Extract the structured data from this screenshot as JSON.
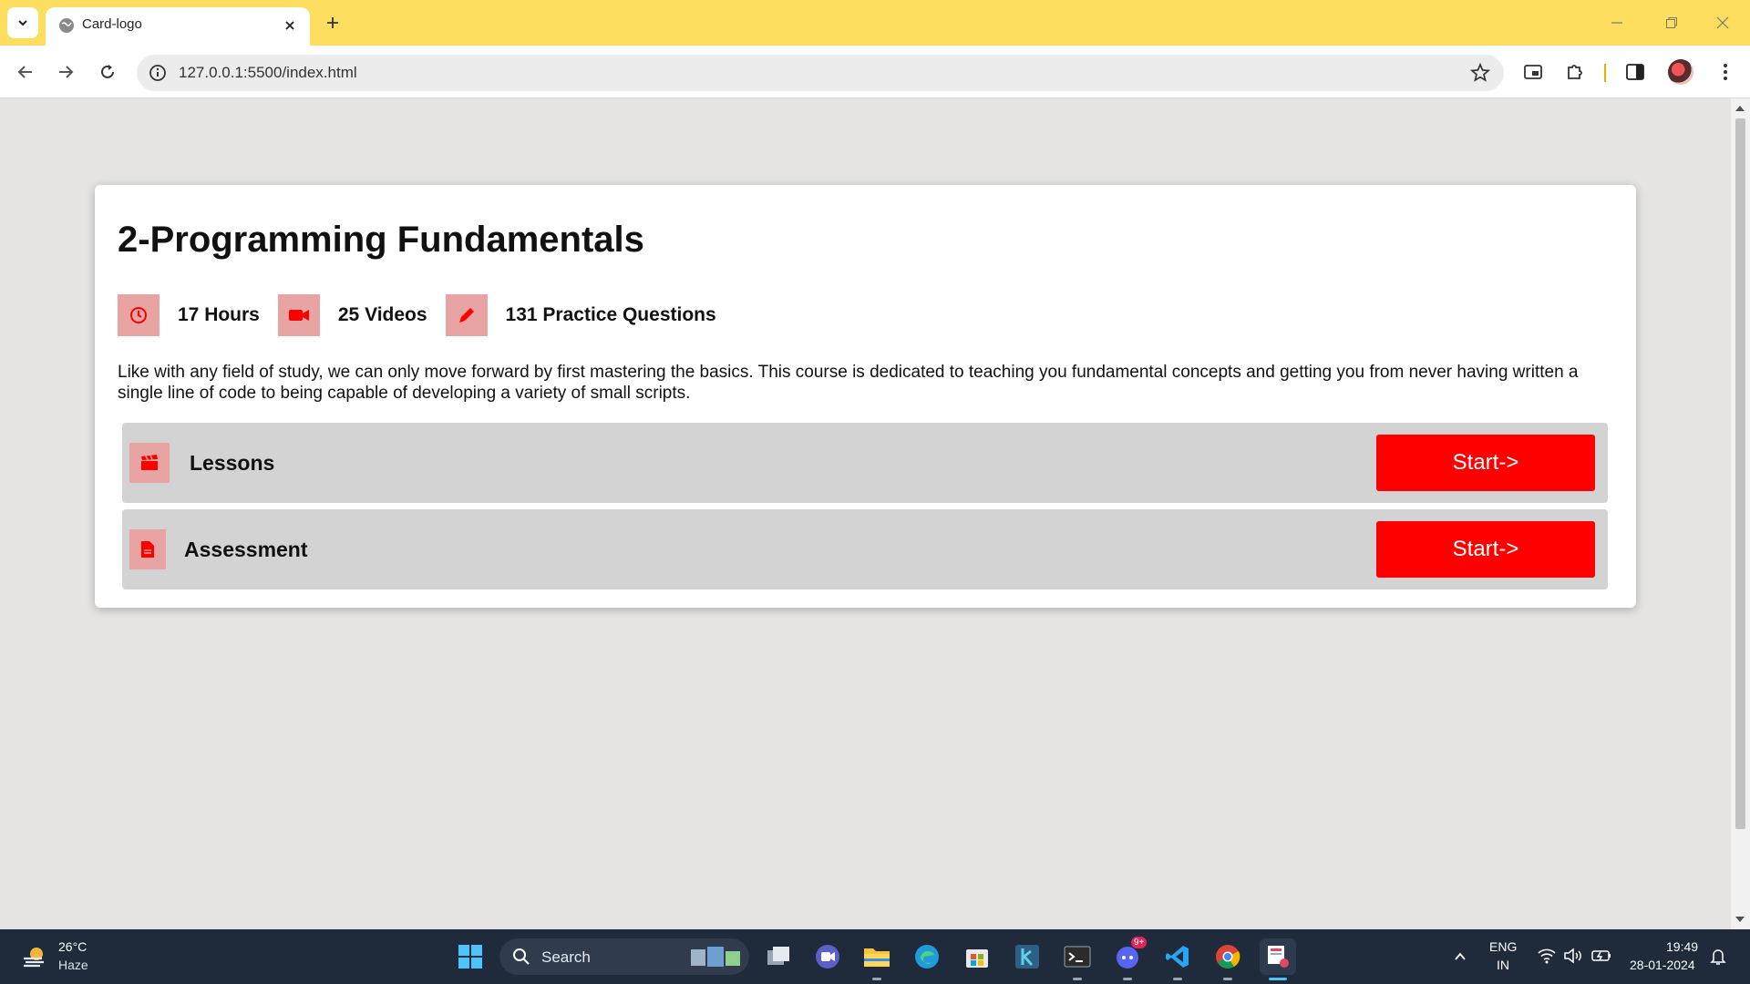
{
  "browser": {
    "tab_title": "Card-logo",
    "url": "127.0.0.1:5500/index.html"
  },
  "card": {
    "title": "2-Programming Fundamentals",
    "stats": [
      {
        "icon": "clock-icon",
        "label": "17 Hours"
      },
      {
        "icon": "video-camera-icon",
        "label": "25 Videos"
      },
      {
        "icon": "pencil-icon",
        "label": "131 Practice Questions"
      }
    ],
    "description": "Like with any field of study, we can only move forward by first mastering the basics. This course is dedicated to teaching you fundamental concepts and getting you from never having written a single line of code to being capable of developing a variety of small scripts.",
    "sections": [
      {
        "icon": "clapperboard-icon",
        "label": "Lessons",
        "button": "Start->"
      },
      {
        "icon": "document-icon",
        "label": "Assessment",
        "button": "Start->"
      }
    ]
  },
  "colors": {
    "accent": "#ff0000",
    "icon_bg": "#e8a3a3",
    "row_bg": "#d3d3d3",
    "page_bg": "#e5e4e3",
    "tabbar_bg": "#fdde5e",
    "taskbar_bg": "#1f2a3b"
  },
  "taskbar": {
    "weather_temp": "26°C",
    "weather_desc": "Haze",
    "search_label": "Search",
    "discord_badge": "9+",
    "lang_line1": "ENG",
    "lang_line2": "IN",
    "time": "19:49",
    "date": "28-01-2024"
  }
}
